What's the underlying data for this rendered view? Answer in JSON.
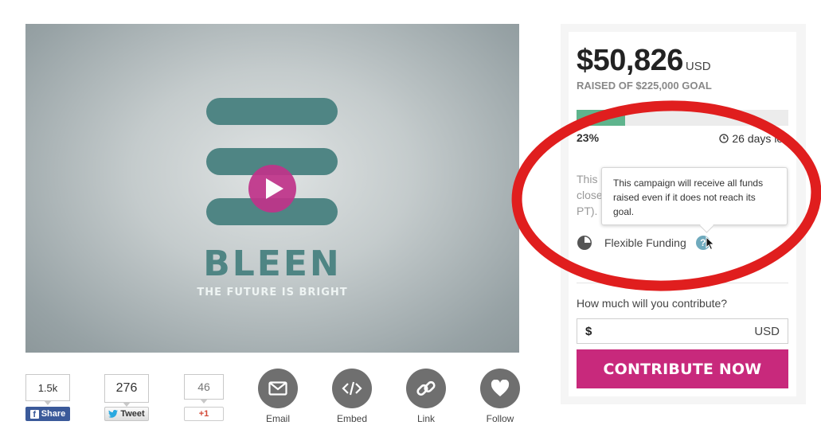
{
  "video": {
    "brand": "BLEEN",
    "tagline": "THE FUTURE IS BRIGHT",
    "play_icon": "play-icon"
  },
  "share": {
    "facebook": {
      "count": "1.5k",
      "label": "Share",
      "icon": "facebook-icon"
    },
    "twitter": {
      "count": "276",
      "label": "Tweet",
      "icon": "twitter-bird-icon"
    },
    "googleplus": {
      "count": "46",
      "label": "+1",
      "icon": "google-plus-icon"
    }
  },
  "actions": [
    {
      "label": "Email",
      "icon": "envelope-icon"
    },
    {
      "label": "Embed",
      "icon": "code-icon"
    },
    {
      "label": "Link",
      "icon": "chain-link-icon"
    },
    {
      "label": "Follow",
      "icon": "heart-icon"
    }
  ],
  "campaign": {
    "amount": "$50,826",
    "currency": "USD",
    "goal_text": "RAISED OF $225,000 GOAL",
    "progress_fraction": 0.23,
    "percent": "23%",
    "days_left": "26 days left",
    "note_lines": [
      "This",
      "close",
      "PT)."
    ],
    "tooltip": "This campaign will receive all funds raised even if it does not reach its goal.",
    "funding_type": "Flexible Funding",
    "help_symbol": "?",
    "contribute_question": "How much will you contribute?",
    "input_prefix": "$",
    "input_suffix": "USD",
    "contribute_button": "CONTRIBUTE NOW"
  },
  "colors": {
    "accent": "#c8297c",
    "progress": "#5fb48d",
    "brand_teal": "#4f8584",
    "annotation": "#e01e1e",
    "facebook": "#3b5a9a"
  }
}
